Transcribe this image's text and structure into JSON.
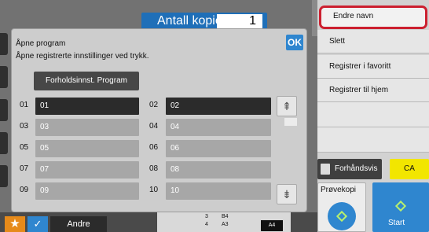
{
  "header": {
    "copies_label": "Antall kopier",
    "copies_value": "1"
  },
  "dialog": {
    "title": "Åpne program",
    "description": "Åpne registrerte innstillinger ved trykk.",
    "ok_label": "OK",
    "settings_button": "Forholdsinnst. Program",
    "slots": [
      {
        "number": "01",
        "label": "01"
      },
      {
        "number": "02",
        "label": "02"
      },
      {
        "number": "03",
        "label": "03"
      },
      {
        "number": "04",
        "label": "04"
      },
      {
        "number": "05",
        "label": "05"
      },
      {
        "number": "06",
        "label": "06"
      },
      {
        "number": "07",
        "label": "07"
      },
      {
        "number": "08",
        "label": "08"
      },
      {
        "number": "09",
        "label": "09"
      },
      {
        "number": "10",
        "label": "10"
      }
    ],
    "scroll_up_icon": "double-chevron-up-icon",
    "scroll_down_icon": "double-chevron-down-icon"
  },
  "right_panel": {
    "items": [
      "Endre navn",
      "Slett",
      "Registrer i favoritt",
      "Registrer til hjem"
    ],
    "preview_label": "Forhåndsvis",
    "ca_label": "CA",
    "proof_label": "Prøvekopi",
    "start_label": "Start"
  },
  "bottom_bar": {
    "other_label": "Andre",
    "tray_labels": [
      "3",
      "B4",
      "4",
      "A3"
    ],
    "paper_size": "A4"
  },
  "colors": {
    "accent": "#2f86cf",
    "highlight": "#cc2030",
    "ca": "#f2e600",
    "favorite": "#e68a1a"
  }
}
